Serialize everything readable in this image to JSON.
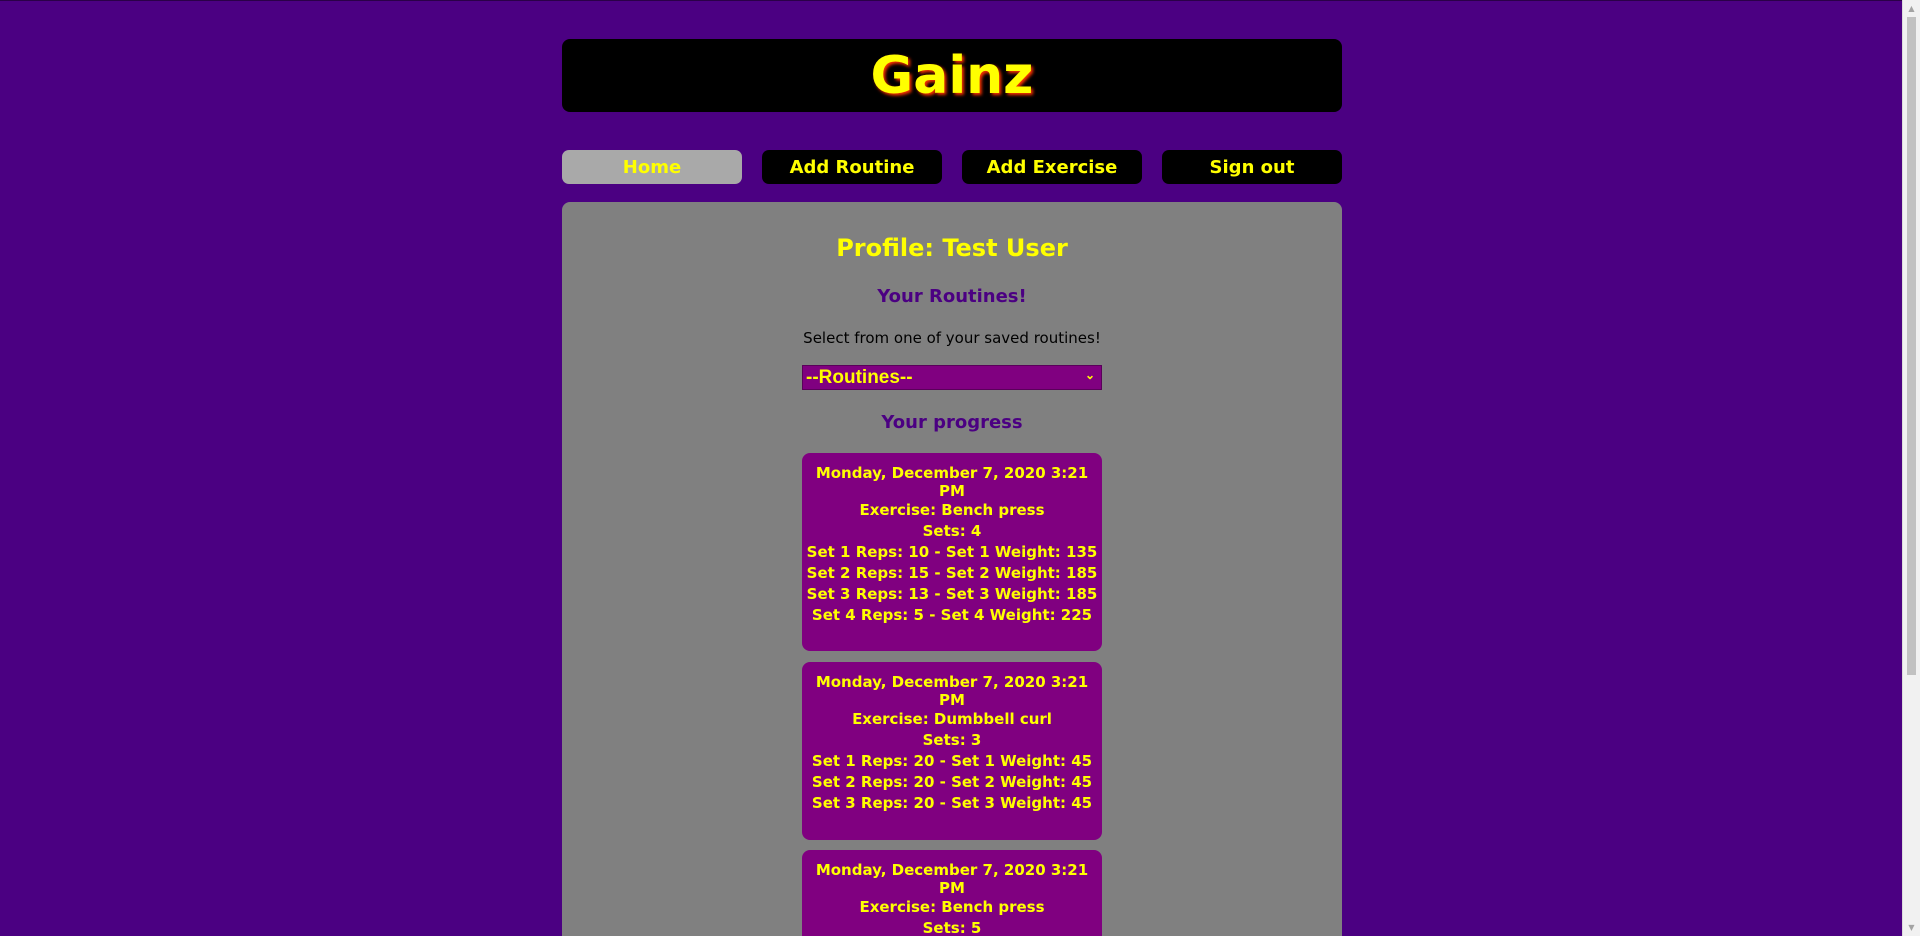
{
  "app": {
    "title": "Gainz"
  },
  "nav": {
    "items": [
      {
        "label": "Home",
        "active": true
      },
      {
        "label": "Add Routine",
        "active": false
      },
      {
        "label": "Add Exercise",
        "active": false
      },
      {
        "label": "Sign out",
        "active": false
      }
    ]
  },
  "profile": {
    "title": "Profile: Test User",
    "routines_heading": "Your Routines!",
    "select_prompt": "Select from one of your saved routines!",
    "routine_select_value": "--Routines--",
    "progress_heading": "Your progress"
  },
  "progress": [
    {
      "date": "Monday, December 7, 2020 3:21 PM",
      "lines": [
        "Exercise: Bench press",
        "Sets: 4",
        "Set 1 Reps: 10 - Set 1 Weight: 135",
        "Set 2 Reps: 15 - Set 2 Weight: 185",
        "Set 3 Reps: 13 - Set 3 Weight: 185",
        "Set 4 Reps: 5 - Set 4 Weight: 225"
      ]
    },
    {
      "date": "Monday, December 7, 2020 3:21 PM",
      "lines": [
        "Exercise: Dumbbell curl",
        "Sets: 3",
        "Set 1 Reps: 20 - Set 1 Weight: 45",
        "Set 2 Reps: 20 - Set 2 Weight: 45",
        "Set 3 Reps: 20 - Set 3 Weight: 45"
      ]
    },
    {
      "date": "Monday, December 7, 2020 3:21 PM",
      "lines": [
        "Exercise: Bench press",
        "Sets: 5"
      ]
    }
  ],
  "colors": {
    "page_background": "#4b0082",
    "accent_text": "#ffff00",
    "card_background": "#800080",
    "panel_background": "#808080",
    "nav_active": "#a9a9a9"
  }
}
